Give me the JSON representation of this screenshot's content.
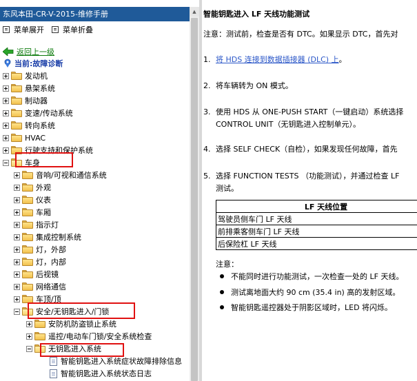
{
  "window": {
    "title": "东风本田-CR-V-2015-维修手册"
  },
  "toolbar": {
    "expand_label": "菜单展开",
    "collapse_label": "菜单折叠"
  },
  "nav": {
    "back_label": "返回上一级",
    "current_label": "当前:故障诊断"
  },
  "tree": {
    "top_items": [
      "发动机",
      "悬架系统",
      "制动器",
      "变速/传动系统",
      "转向系统",
      "HVAC",
      "行驶支持和保护系统",
      "车身"
    ],
    "body_children": [
      "音响/可视和通信系统",
      "外观",
      "仪表",
      "车厢",
      "指示灯",
      "集成控制系统",
      "灯，外部",
      "灯，内部",
      "后视镜",
      "网络通信",
      "车顶/顶",
      "安全/无钥匙进入/门锁"
    ],
    "security_children": [
      "安防机防盗锁止系统",
      "遥控/电动车门锁/安全系统检查",
      "无钥匙进入系统"
    ],
    "keyless_children": [
      "智能钥匙进入系统症状故障排除信息",
      "智能钥匙进入系统状态日志"
    ]
  },
  "content": {
    "title": "智能钥匙进入 LF 天线功能测试",
    "note": "注意：测试前，检查是否有 DTC。如果显示 DTC，首先对",
    "steps": [
      {
        "num": "1.",
        "link": "将 HDS 连接到数据插接器 (DLC) 上",
        "after": "。"
      },
      {
        "num": "2.",
        "text": "将车辆转为 ON 模式。"
      },
      {
        "num": "3.",
        "line1": "使用 HDS 从 ONE-PUSH START（一键启动）系统选择",
        "line2": "CONTROL UNIT（无钥匙进入控制单元）。"
      },
      {
        "num": "4.",
        "text": "选择 SELF CHECK（自检），如果发现任何故障，首先"
      },
      {
        "num": "5.",
        "line1": "选择 FUNCTION TESTS （功能测试），并通过检查 LF",
        "line2": "测试。"
      }
    ],
    "table": {
      "header": "LF 天线位置",
      "rows": [
        "驾驶员侧车门 LF 天线",
        "前排乘客侧车门 LF 天线",
        "后保险杠 LF 天线"
      ]
    },
    "note_label": "注意：",
    "bullets": [
      "不能同时进行功能测试，一次检查一处的 LF 天线。",
      "测试离地面大约 90 cm (35.4 in) 高的发射区域。",
      "智能钥匙遥控器处于阴影区域时，LED 将闪烁。"
    ]
  },
  "colors": {
    "title_bar": "#1f5a99",
    "highlight": "#e01010",
    "link": "#2b57c8",
    "back_link": "#0b7a0b",
    "current": "#1a3ea8"
  }
}
